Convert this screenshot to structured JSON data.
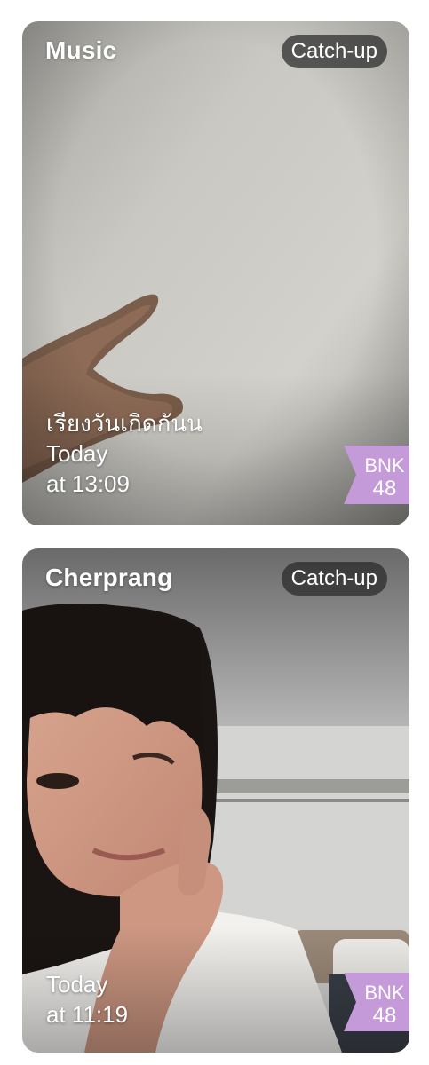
{
  "cards": [
    {
      "member": "Music",
      "badge": "Catch-up",
      "title": "เรียงวันเกิดกันน",
      "day": "Today",
      "time": "at 13:09"
    },
    {
      "member": "Cherprang",
      "badge": "Catch-up",
      "day": "Today",
      "time": "at 11:19"
    }
  ],
  "logo": {
    "line1": "BNK",
    "line2": "48",
    "color": "#c49bd8"
  }
}
